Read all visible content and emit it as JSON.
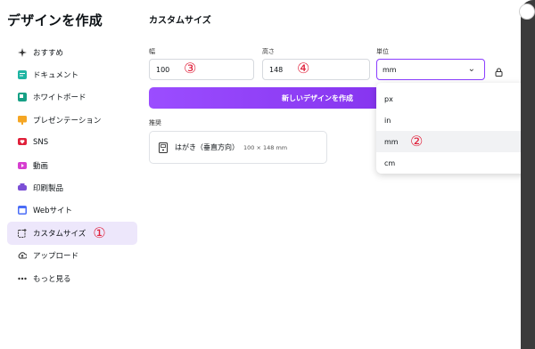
{
  "sidebar": {
    "title": "デザインを作成",
    "items": [
      {
        "label": "おすすめ",
        "icon": "sparkle-icon",
        "color": "#333333"
      },
      {
        "label": "ドキュメント",
        "icon": "document-icon",
        "color": "#1fb5a3"
      },
      {
        "label": "ホワイトボード",
        "icon": "whiteboard-icon",
        "color": "#16a085"
      },
      {
        "label": "プレゼンテーション",
        "icon": "presentation-icon",
        "color": "#f5a623"
      },
      {
        "label": "SNS",
        "icon": "heart-icon",
        "color": "#e0203a"
      },
      {
        "label": "動画",
        "icon": "video-icon",
        "color": "#d63fd0"
      },
      {
        "label": "印刷製品",
        "icon": "print-icon",
        "color": "#7b4fd6"
      },
      {
        "label": "Webサイト",
        "icon": "website-icon",
        "color": "#4a6cf7"
      },
      {
        "label": "カスタムサイズ",
        "icon": "custom-size-icon",
        "color": "#333333",
        "annotation": "①"
      },
      {
        "label": "アップロード",
        "icon": "upload-icon",
        "color": "#333333"
      },
      {
        "label": "もっと見る",
        "icon": "more-icon",
        "color": "#333333"
      }
    ]
  },
  "main": {
    "title": "カスタムサイズ",
    "width_label": "幅",
    "width_value": "100",
    "width_annotation": "③",
    "height_label": "高さ",
    "height_value": "148",
    "height_annotation": "④",
    "unit_label": "単位",
    "unit_value": "mm",
    "create_button": "新しいデザインを作成",
    "recommend_label": "推奨",
    "recommend_item": "はがき（垂直方向）",
    "recommend_dims": "100 × 148 mm"
  },
  "dropdown": {
    "options": [
      "px",
      "in",
      "mm",
      "cm"
    ],
    "selected": "mm",
    "annotation": "②"
  },
  "colors": {
    "accent": "#8b3dff",
    "annotation": "#e0203a",
    "active_bg": "#ede7fb"
  }
}
